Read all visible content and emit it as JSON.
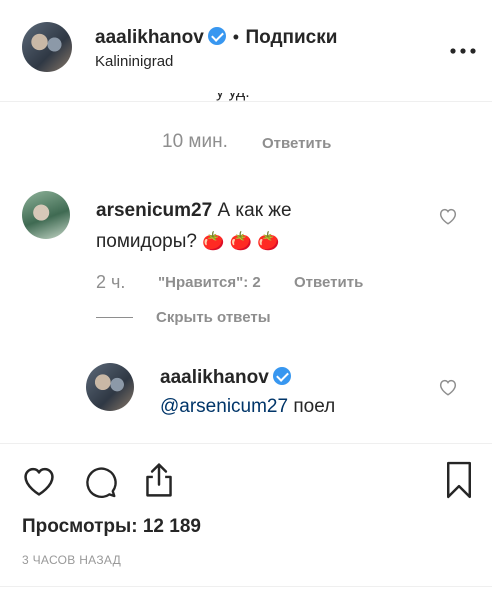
{
  "header": {
    "username": "aaalikhanov",
    "separator": "•",
    "follow_label": "Подписки",
    "location": "Kalininigrad",
    "more_icon": "more-horizontal-icon"
  },
  "comments": {
    "partial_text": "у уд.",
    "first_meta": {
      "time": "10 мин.",
      "reply": "Ответить"
    },
    "second": {
      "username": "arsenicum27",
      "text_line1": "А как же",
      "text_line2": "помидоры?",
      "emoji": "🍅 🍅 🍅",
      "time": "2 ч.",
      "likes": "\"Нравится\": 2",
      "reply": "Ответить"
    },
    "hide_replies": "Скрыть ответы",
    "reply": {
      "username": "aaalikhanov",
      "mention": "@arsenicum27",
      "text": "поел"
    }
  },
  "actions": {
    "like_icon": "heart-icon",
    "comment_icon": "comment-icon",
    "share_icon": "share-icon",
    "save_icon": "bookmark-icon"
  },
  "views": "Просмотры: 12 189",
  "timestamp": "3 ЧАСОВ НАЗАД",
  "colors": {
    "verified": "#3897f0",
    "link": "#003569",
    "muted": "#8e8e8e"
  }
}
